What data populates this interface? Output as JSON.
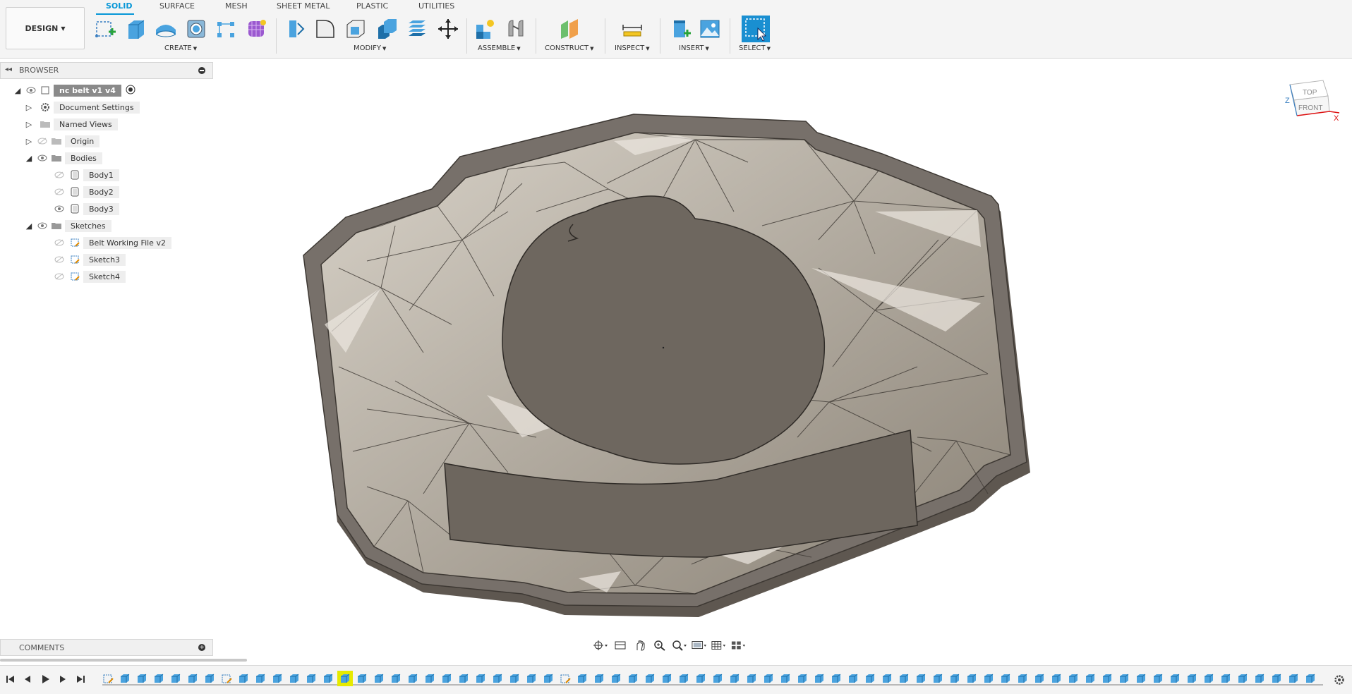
{
  "workspace": {
    "label": "DESIGN"
  },
  "tabs": [
    {
      "label": "SOLID",
      "active": true
    },
    {
      "label": "SURFACE",
      "active": false
    },
    {
      "label": "MESH",
      "active": false
    },
    {
      "label": "SHEET METAL",
      "active": false
    },
    {
      "label": "PLASTIC",
      "active": false
    },
    {
      "label": "UTILITIES",
      "active": false
    }
  ],
  "groups": {
    "create": "CREATE",
    "modify": "MODIFY",
    "assemble": "ASSEMBLE",
    "construct": "CONSTRUCT",
    "inspect": "INSPECT",
    "insert": "INSERT",
    "select": "SELECT"
  },
  "browser": {
    "title": "BROWSER",
    "root": "nc belt v1 v4",
    "items": [
      {
        "label": "Document Settings",
        "icon": "gear-icon"
      },
      {
        "label": "Named Views",
        "icon": "folder-icon"
      },
      {
        "label": "Origin",
        "icon": "folder-icon"
      },
      {
        "label": "Bodies",
        "icon": "folder-icon"
      },
      {
        "label": "Body1",
        "icon": "body-icon"
      },
      {
        "label": "Body2",
        "icon": "body-icon"
      },
      {
        "label": "Body3",
        "icon": "body-icon"
      },
      {
        "label": "Sketches",
        "icon": "folder-icon"
      },
      {
        "label": "Belt Working File v2",
        "icon": "sketch-icon"
      },
      {
        "label": "Sketch3",
        "icon": "sketch-icon"
      },
      {
        "label": "Sketch4",
        "icon": "sketch-icon"
      }
    ]
  },
  "comments": {
    "title": "COMMENTS"
  },
  "viewcube": {
    "top": "TOP",
    "front": "FRONT",
    "axis_x": "X",
    "axis_z": "Z"
  },
  "colors": {
    "accent": "#0696d7",
    "timeline_marker": "#e6ea00",
    "model": "#7a736a"
  }
}
